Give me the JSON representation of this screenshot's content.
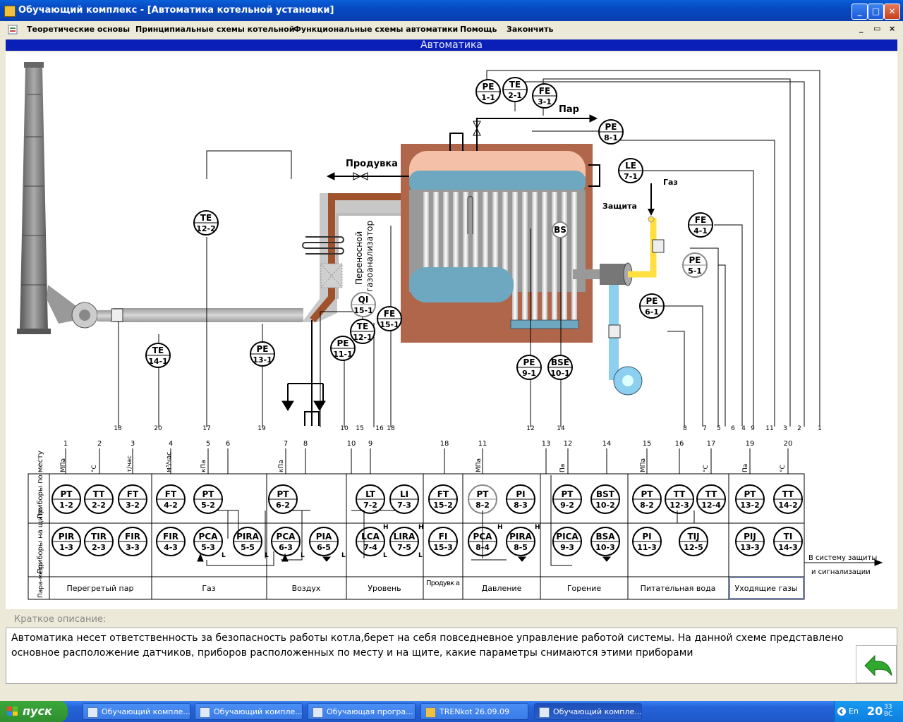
{
  "window": {
    "title": "Обучающий комплекс - [Автоматика котельной установки]",
    "buttons": {
      "min": "_",
      "max": "□",
      "close": "✕"
    }
  },
  "menu": {
    "items": [
      "Теоретические основы",
      "Принципиальные схемы котельной",
      "Функциональные схемы автоматики",
      "Помощь",
      "Закончить"
    ],
    "right_min": "_",
    "right_restore": "▭",
    "right_close": "×"
  },
  "banner": "Автоматика",
  "diagram": {
    "labels": {
      "steam": "Пар",
      "blowdown": "Продувка",
      "gas": "Газ",
      "protection": "Защита",
      "analyzer_1": "Переносной",
      "analyzer_2": "газоанализатор",
      "to_protection_1": "В систему защиты",
      "to_protection_2": "и сигнализации"
    },
    "field_instruments": [
      {
        "id": "pe11",
        "t": "PE",
        "n": "1-1"
      },
      {
        "id": "te21",
        "t": "TE",
        "n": "2-1"
      },
      {
        "id": "fe31",
        "t": "FE",
        "n": "3-1"
      },
      {
        "id": "pe81",
        "t": "PE",
        "n": "8-1"
      },
      {
        "id": "le71",
        "t": "LE",
        "n": "7-1"
      },
      {
        "id": "fe41",
        "t": "FE",
        "n": "4-1"
      },
      {
        "id": "pe51",
        "t": "PE",
        "n": "5-1"
      },
      {
        "id": "pe61",
        "t": "PE",
        "n": "6-1"
      },
      {
        "id": "te122",
        "t": "TE",
        "n": "12-2"
      },
      {
        "id": "te141",
        "t": "TE",
        "n": "14-1"
      },
      {
        "id": "pe131",
        "t": "PE",
        "n": "13-1"
      },
      {
        "id": "qi151",
        "t": "QI",
        "n": "15-1"
      },
      {
        "id": "fe151",
        "t": "FE",
        "n": "15-1"
      },
      {
        "id": "te121",
        "t": "TE",
        "n": "12-1"
      },
      {
        "id": "pe111",
        "t": "PE",
        "n": "11-1"
      },
      {
        "id": "pe91",
        "t": "PE",
        "n": "9-1"
      },
      {
        "id": "bse101",
        "t": "BSE",
        "n": "10-1"
      },
      {
        "id": "bs",
        "t": "BS",
        "n": ""
      }
    ],
    "line_numbers_bottom": [
      "13",
      "20",
      "17",
      "19",
      "10",
      "15",
      "16",
      "18",
      "12",
      "14",
      "8",
      "7",
      "5",
      "6",
      "4",
      "9",
      "11",
      "3",
      "2",
      "1"
    ],
    "channel_numbers": [
      "1",
      "2",
      "3",
      "4",
      "5",
      "6",
      "7",
      "8",
      "10",
      "9",
      "18",
      "11",
      "13",
      "12",
      "14",
      "15",
      "16",
      "17",
      "19",
      "20"
    ],
    "units": [
      "МПа",
      "°С",
      "т/час",
      "м³/час",
      "кПа",
      "кПа",
      "МПа",
      "Па",
      "МПа",
      "°С",
      "Па",
      "°С"
    ],
    "row_headers": [
      "Приборы по месту",
      "Приборы на щите",
      "Пара-метр"
    ],
    "local_instruments": [
      {
        "t": "PT",
        "n": "1-2"
      },
      {
        "t": "TT",
        "n": "2-2"
      },
      {
        "t": "FT",
        "n": "3-2"
      },
      {
        "t": "FT",
        "n": "4-2"
      },
      {
        "t": "PT",
        "n": "5-2"
      },
      {
        "t": "PT",
        "n": "6-2"
      },
      {
        "t": "LT",
        "n": "7-2"
      },
      {
        "t": "LI",
        "n": "7-3"
      },
      {
        "t": "FT",
        "n": "15-2"
      },
      {
        "t": "PT",
        "n": "8-2"
      },
      {
        "t": "PI",
        "n": "8-3"
      },
      {
        "t": "PT",
        "n": "9-2"
      },
      {
        "t": "BST",
        "n": "10-2"
      },
      {
        "t": "PT",
        "n": "8-2"
      },
      {
        "t": "TT",
        "n": "12-3"
      },
      {
        "t": "TT",
        "n": "12-4"
      },
      {
        "t": "PT",
        "n": "13-2"
      },
      {
        "t": "TT",
        "n": "14-2"
      }
    ],
    "panel_instruments": [
      {
        "t": "PIR",
        "n": "1-3"
      },
      {
        "t": "TIR",
        "n": "2-3"
      },
      {
        "t": "FIR",
        "n": "3-3"
      },
      {
        "t": "FIR",
        "n": "4-3"
      },
      {
        "t": "PCA",
        "n": "5-3"
      },
      {
        "t": "PIRA",
        "n": "5-5"
      },
      {
        "t": "PCA",
        "n": "6-3"
      },
      {
        "t": "PIA",
        "n": "6-5"
      },
      {
        "t": "LCA",
        "n": "7-4"
      },
      {
        "t": "LIRA",
        "n": "7-5"
      },
      {
        "t": "FI",
        "n": "15-3"
      },
      {
        "t": "PCA",
        "n": "8-4"
      },
      {
        "t": "PIRA",
        "n": "8-5"
      },
      {
        "t": "PICA",
        "n": "9-3"
      },
      {
        "t": "BSA",
        "n": "10-3"
      },
      {
        "t": "PI",
        "n": "11-3"
      },
      {
        "t": "TIJ",
        "n": "12-5"
      },
      {
        "t": "PIJ",
        "n": "13-3"
      },
      {
        "t": "TI",
        "n": "14-3"
      }
    ],
    "alarm_marks": [
      "L",
      "L",
      "L",
      "L",
      "H",
      "L",
      "H",
      "L",
      "H",
      "H"
    ],
    "parameters": [
      "Перегретый пар",
      "Газ",
      "Воздух",
      "Уровень",
      "Продувк а",
      "Давление",
      "Горение",
      "Питательная вода",
      "Уходящие газы"
    ]
  },
  "description": {
    "label": "Краткое описание:",
    "text": "Автоматика несет ответственность за безопасность работы котла,берет на себя повседневное управление работой системы. На данной схеме представлено основное расположение датчиков, приборов расположенных по месту и на щите, какие параметры снимаются этими приборами"
  },
  "taskbar": {
    "start": "пуск",
    "tasks": [
      "Обучающий компле...",
      "Обучающий компле...",
      "Обучающая програ...",
      "TRENkot 26.09.09",
      "Обучающий компле..."
    ],
    "lang": "En",
    "time": "20",
    "time_small_1": "33",
    "time_small_2": "BC"
  }
}
